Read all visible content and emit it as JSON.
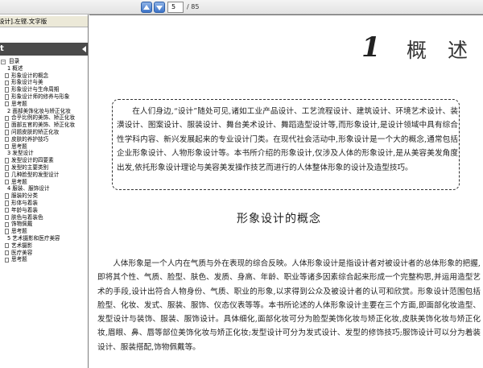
{
  "toolbar": {
    "page_current": "5",
    "page_total": "/ 85"
  },
  "sidebar": {
    "tab_title": "设计].左铿.文字版",
    "panel_title": "t",
    "tree": [
      {
        "label": "目录",
        "level": 0,
        "type": "exp"
      },
      {
        "label": "1  概述",
        "level": 1,
        "type": "exp"
      },
      {
        "label": "形象设计的概念",
        "level": 2,
        "type": "doc"
      },
      {
        "label": "形象设计与美",
        "level": 2,
        "type": "doc"
      },
      {
        "label": "形象设计与生命周期",
        "level": 2,
        "type": "doc"
      },
      {
        "label": "形象设计师的修养与形象",
        "level": 2,
        "type": "doc"
      },
      {
        "label": "思考题",
        "level": 2,
        "type": "doc"
      },
      {
        "label": "2  面部美饰化妆与矫正化妆",
        "level": 1,
        "type": "exp"
      },
      {
        "label": "合乎比例的美饰、矫正化妆",
        "level": 2,
        "type": "doc"
      },
      {
        "label": "面部五官的美饰、矫正化妆",
        "level": 2,
        "type": "doc"
      },
      {
        "label": "问题皮肤的矫正化妆",
        "level": 2,
        "type": "doc"
      },
      {
        "label": "皮肤的养护技巧",
        "level": 2,
        "type": "doc"
      },
      {
        "label": "思考题",
        "level": 2,
        "type": "doc"
      },
      {
        "label": "3  发型设计",
        "level": 1,
        "type": "exp"
      },
      {
        "label": "发型设计的四要素",
        "level": 2,
        "type": "doc"
      },
      {
        "label": "发型的主要类别",
        "level": 2,
        "type": "doc"
      },
      {
        "label": "几种脸型的发型设计",
        "level": 2,
        "type": "doc"
      },
      {
        "label": "思考题",
        "level": 2,
        "type": "doc"
      },
      {
        "label": "4  服装、服饰设计",
        "level": 1,
        "type": "exp"
      },
      {
        "label": "服装的分类",
        "level": 2,
        "type": "doc"
      },
      {
        "label": "形体与着装",
        "level": 2,
        "type": "doc"
      },
      {
        "label": "年龄与着装",
        "level": 2,
        "type": "doc"
      },
      {
        "label": "肤色与着装色",
        "level": 2,
        "type": "doc"
      },
      {
        "label": "饰物佩戴",
        "level": 2,
        "type": "doc"
      },
      {
        "label": "思考题",
        "level": 2,
        "type": "doc"
      },
      {
        "label": "5  艺术摄影和医疗美容",
        "level": 1,
        "type": "exp"
      },
      {
        "label": "艺术摄影",
        "level": 2,
        "type": "doc"
      },
      {
        "label": "医疗美容",
        "level": 2,
        "type": "doc"
      },
      {
        "label": "思考题",
        "level": 2,
        "type": "doc"
      }
    ]
  },
  "document": {
    "chapter_number": "1",
    "chapter_title": "概述",
    "intro": "在人们身边,“设计”随处可见,诸如工业产品设计、工艺流程设计、建筑设计、环境艺术设计、装潢设计、图案设计、服装设计、舞台美术设计、舞蹈造型设计等,而形象设计,是设计领域中具有综合性学科内容、新兴发展起来的专业设计门类。在现代社会活动中,形象设计是一个大的概念,通常包括企业形象设计、人物形象设计等。本书所介绍的形象设计,仅涉及人体的形象设计,是从美容美发角度出发,依托形象设计理论与美容美发操作技艺而进行的人体整体形象的设计及造型技巧。",
    "section_title": "形象设计的概念",
    "body": "人体形象是一个人内在气质与外在表现的综合反映。人体形象设计是指设计者对被设计者的总体形象的把握,即将其个性、气质、脸型、肤色、发质、身高、年龄、职业等诸多因素综合起来形成一个完整构思,并运用造型艺术的手段,设计出符合人物身份、气质、职业的形象,以求得到公众及被设计者的认可和欣赏。形象设计范围包括脸型、化妆、发式、服装、服饰、仪态仪表等等。本书所论述的人体形象设计主要在三个方面,即面部化妆造型、发型设计与装饰、服装、服饰设计。具体细化,面部化妆可分为脸型美饰化妆与矫正化妆,皮肤美饰化妆与矫正化妆,眉眼、鼻、唇等部位美饰化妆与矫正化妆;发型设计可分为发式设计、发型的修饰技巧;服饰设计可以分为着装设计、服装搭配,饰物佩戴等。"
  }
}
